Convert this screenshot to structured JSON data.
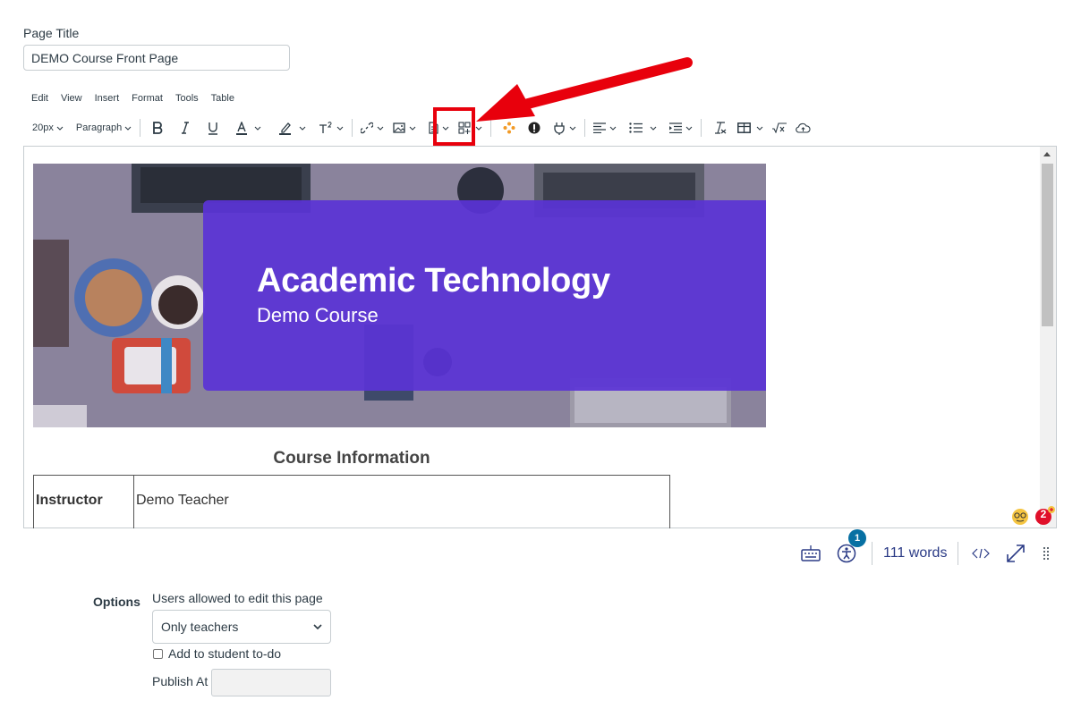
{
  "page_title": {
    "label": "Page Title",
    "value": "DEMO Course Front Page"
  },
  "menubar": {
    "items": [
      "Edit",
      "View",
      "Insert",
      "Format",
      "Tools",
      "Table"
    ]
  },
  "toolbar": {
    "font_size": "20px",
    "block_format": "Paragraph"
  },
  "banner": {
    "title": "Academic Technology",
    "subtitle": "Demo Course"
  },
  "content": {
    "heading": "Course Information",
    "table": {
      "label": "Instructor",
      "value": "Demo Teacher"
    }
  },
  "status": {
    "word_count": "111 words",
    "a11y_badge": "1",
    "checker_badge": "2"
  },
  "options": {
    "label": "Options",
    "users_label": "Users allowed to edit this page",
    "users_value": "Only teachers",
    "todo_label": "Add to student to-do",
    "publish_label": "Publish At"
  },
  "colors": {
    "accent": "#5a33d6",
    "highlight": "#e8000c",
    "badge": "#0770a3",
    "link": "#2b3b86"
  }
}
